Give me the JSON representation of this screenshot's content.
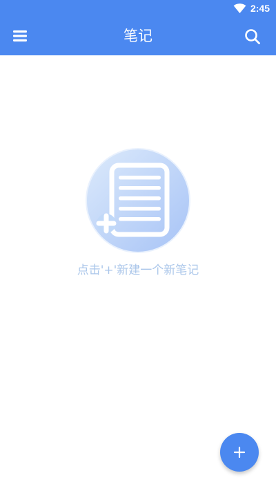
{
  "status_bar": {
    "time": "2:45",
    "wifi_icon": "wifi-icon"
  },
  "toolbar": {
    "title": "笔记",
    "menu_icon": "menu-icon",
    "search_icon": "search-icon"
  },
  "empty_state": {
    "illustration_icon": "empty-notes-icon",
    "hint": "点击'+'新建一个新笔记"
  },
  "fab": {
    "icon": "add-icon"
  },
  "colors": {
    "primary": "#4b88f0",
    "hint_text": "#aac6ea",
    "illustration_light": "#d7e8fb",
    "illustration_dark": "#a9c6f7",
    "background": "#ffffff"
  }
}
